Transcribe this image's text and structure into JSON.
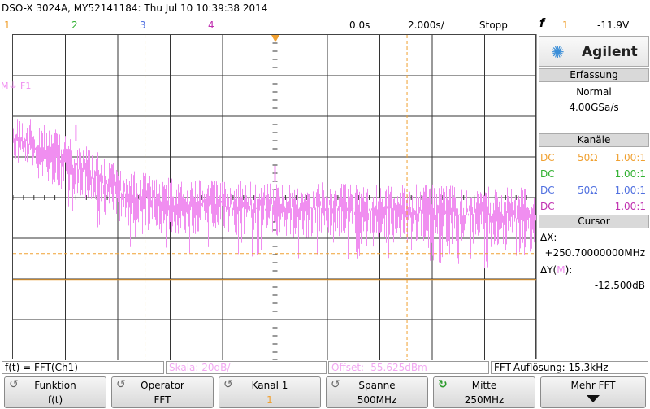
{
  "header": {
    "device": "DSO-X 3024A, MY52141184: Thu Jul 10 10:39:38 2014",
    "channels": [
      {
        "label": "1",
        "color": "#f0a030"
      },
      {
        "label": "2",
        "color": "#30b030"
      },
      {
        "label": "3",
        "color": "#5070e0"
      },
      {
        "label": "4",
        "color": "#c030b0"
      }
    ],
    "time_offset": "0.0s",
    "timebase": "2.000s/",
    "run_state": "Stopp",
    "trigger_symbol": "f",
    "trigger_channel": "1",
    "trigger_level": "-11.9V"
  },
  "plot": {
    "marker_label": "F1",
    "trace_color": "#f08ef0",
    "cursor_color": "#f0a030",
    "grid_divisions_x": 10,
    "grid_divisions_y": 8,
    "cursor_x_fractions": [
      0.252,
      0.752
    ],
    "cursor_y_fractions": [
      0.672,
      0.752
    ]
  },
  "chart_data": {
    "type": "line",
    "title": "",
    "xlabel": "",
    "ylabel": "",
    "x_center_mhz": 250,
    "x_span_mhz": 500,
    "xlim_mhz": [
      0,
      500
    ],
    "y_scale_db_per_div": 20,
    "y_offset_dbm": -55.625,
    "series": [
      {
        "x_mhz": [
          0,
          10,
          20,
          30,
          40,
          50,
          60,
          70,
          80,
          90,
          100,
          110,
          120,
          130,
          140,
          150,
          160,
          170,
          180,
          190,
          200,
          210,
          220,
          230,
          240,
          250,
          260,
          270,
          280,
          290,
          300,
          310,
          320,
          330,
          340,
          350,
          360,
          370,
          380,
          390,
          400,
          410,
          420,
          430,
          440,
          450,
          460,
          470,
          480,
          490,
          500
        ],
        "upper_dbm": [
          -13,
          -15,
          -18,
          -20,
          -22,
          -25,
          -28,
          -30,
          -33,
          -37,
          -39,
          -42,
          -43,
          -44,
          -45,
          -46,
          -47,
          -47,
          -47,
          -47,
          -47,
          -47,
          -47,
          -48,
          -48,
          -48,
          -48,
          -48,
          -48,
          -48,
          -48,
          -48,
          -49,
          -49,
          -49,
          -49,
          -49,
          -49,
          -49,
          -49,
          -49,
          -49,
          -50,
          -50,
          -50,
          -50,
          -50,
          -50,
          -50,
          -50,
          -50
        ],
        "lower_dbm": [
          -40,
          -42,
          -45,
          -48,
          -50,
          -53,
          -56,
          -58,
          -62,
          -65,
          -68,
          -70,
          -72,
          -72,
          -73,
          -73,
          -74,
          -74,
          -74,
          -75,
          -75,
          -75,
          -75,
          -75,
          -75,
          -75,
          -76,
          -76,
          -76,
          -76,
          -76,
          -76,
          -77,
          -77,
          -78,
          -78,
          -78,
          -78,
          -78,
          -79,
          -80,
          -80,
          -80,
          -80,
          -81,
          -81,
          -82,
          -82,
          -82,
          -83,
          -83
        ]
      }
    ],
    "spurs_mhz": [
      60,
      250
    ]
  },
  "panel": {
    "brand": "Agilent",
    "acquisition_header": "Erfassung",
    "acquisition_mode": "Normal",
    "sample_rate": "4.00GSa/s",
    "channels_header": "Kanäle",
    "channels": [
      {
        "coupling": "DC",
        "impedance": "50Ω",
        "probe": "1.00:1",
        "color": "#f0a030"
      },
      {
        "coupling": "DC",
        "impedance": "",
        "probe": "1.00:1",
        "color": "#30b030"
      },
      {
        "coupling": "DC",
        "impedance": "50Ω",
        "probe": "1.00:1",
        "color": "#5070e0"
      },
      {
        "coupling": "DC",
        "impedance": "",
        "probe": "1.00:1",
        "color": "#c030b0"
      }
    ],
    "cursor_header": "Cursor",
    "dx_label": "ΔX:",
    "dx_value": "+250.70000000MHz",
    "dy_label": "ΔY(",
    "dy_unit_label": "M",
    "dy_label_end": "):",
    "dy_value": "-12.500dB"
  },
  "info": {
    "function": "f(t) = FFT(Ch1)",
    "scale": "Skala: 20dB/",
    "offset": "Offset: -55.625dBm",
    "resolution": "FFT-Auflösung: 15.3kHz"
  },
  "softkeys": [
    {
      "l1": "Funktion",
      "l2": "f(t)"
    },
    {
      "l1": "Operator",
      "l2": "FFT"
    },
    {
      "l1": "Kanal 1",
      "l2": "1"
    },
    {
      "l1": "Spanne",
      "l2": "500MHz"
    },
    {
      "l1": "Mitte",
      "l2": "250MHz"
    },
    {
      "l1": "Mehr FFT",
      "l2": ""
    }
  ]
}
